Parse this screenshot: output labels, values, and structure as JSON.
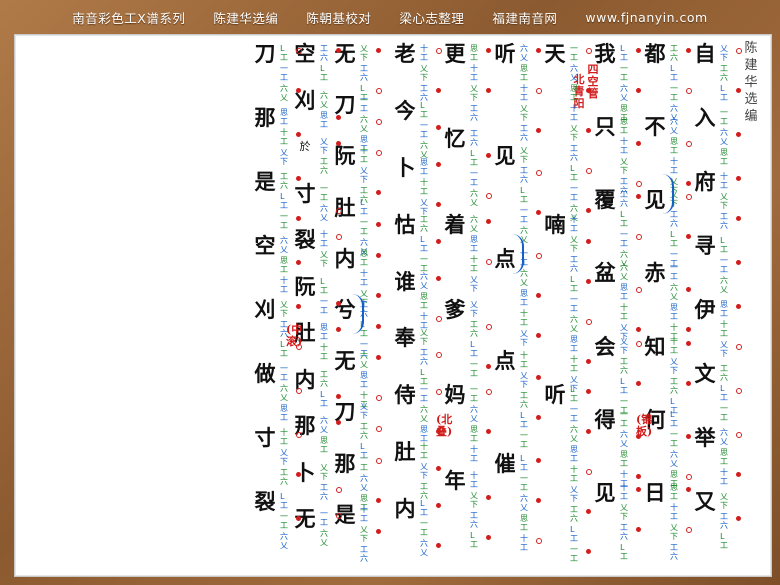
{
  "header": {
    "series": "南音彩色工X谱系列",
    "compiler": "陈建华选编",
    "proofreader": "陈朝基校对",
    "arranger": "梁心志整理",
    "site": "福建南音网",
    "url": "www.fjnanyin.com"
  },
  "editor_note": "陈建华选编",
  "columns": [
    {
      "lyrics": [
        "自",
        "入",
        "府",
        "寻",
        "伊",
        "文",
        "举",
        "又"
      ],
      "annotations": []
    },
    {
      "lyrics": [
        "都",
        "不",
        "见",
        "赤",
        "知",
        "何",
        "日"
      ],
      "annotations": [
        "(锦板)"
      ]
    },
    {
      "lyrics": [
        "我",
        "只",
        "覆",
        "盆",
        "会",
        "得",
        "见"
      ],
      "annotations": [
        "四空管",
        "北青阳"
      ]
    },
    {
      "lyrics": [
        "天",
        "喃",
        "听"
      ],
      "annotations": []
    },
    {
      "lyrics": [
        "听",
        "见",
        "点",
        "点",
        "催"
      ],
      "annotations": []
    },
    {
      "lyrics": [
        "更",
        "忆",
        "着",
        "爹",
        "妈",
        "年"
      ],
      "annotations": [
        "(北叠)"
      ]
    },
    {
      "lyrics": [
        "老",
        "今",
        "卜",
        "怙",
        "谁",
        "奉",
        "侍",
        "肚",
        "内"
      ],
      "annotations": []
    },
    {
      "lyrics": [
        "无",
        "刀",
        "阮",
        "肚",
        "内",
        "兮",
        "无",
        "刀",
        "那",
        "是"
      ],
      "annotations": []
    },
    {
      "lyrics": [
        "空",
        "刈",
        "於",
        "寸",
        "裂",
        "阮",
        "肚",
        "内",
        "那",
        "卜",
        "无"
      ],
      "annotations": [
        "(中滚)"
      ]
    },
    {
      "lyrics": [
        "刀",
        "那",
        "是",
        "空",
        "刈",
        "做",
        "寸",
        "裂"
      ],
      "annotations": []
    }
  ],
  "colors": {
    "lyric": "#111111",
    "notation_green": "#1a8a2a",
    "notation_blue": "#1560c8",
    "marker_red": "#d21d1d",
    "frame": "#8c5a30"
  }
}
